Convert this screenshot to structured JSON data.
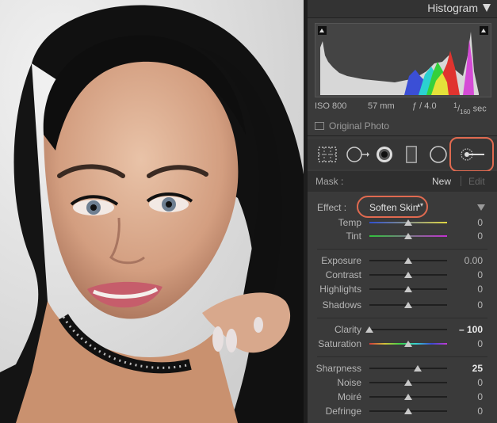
{
  "colors": {
    "accent_highlight": "#e06a50",
    "panel_bg": "#3a3a3a"
  },
  "histogram": {
    "title": "Histogram",
    "iso": "ISO 800",
    "focal_length": "57 mm",
    "aperture": "ƒ / 4.0",
    "shutter_num": "1",
    "shutter_den": "160",
    "shutter_unit": "sec",
    "original_photo_label": "Original Photo"
  },
  "toolbar": {
    "tools": [
      "crop-overlay-icon",
      "spot-removal-icon",
      "red-eye-icon",
      "graduated-filter-icon",
      "radial-filter-icon",
      "adjustment-brush-icon"
    ],
    "active_tool": "adjustment-brush-icon"
  },
  "mask": {
    "label": "Mask :",
    "new_label": "New",
    "edit_label": "Edit"
  },
  "effect": {
    "label": "Effect :",
    "value": "Soften Skin",
    "arrows": "▴▾"
  },
  "sliders": {
    "temp": {
      "label": "Temp",
      "value": "0",
      "level": 0.5
    },
    "tint": {
      "label": "Tint",
      "value": "0",
      "level": 0.5
    },
    "exposure": {
      "label": "Exposure",
      "value": "0.00",
      "level": 0.5
    },
    "contrast": {
      "label": "Contrast",
      "value": "0",
      "level": 0.5
    },
    "highlights": {
      "label": "Highlights",
      "value": "0",
      "level": 0.5
    },
    "shadows": {
      "label": "Shadows",
      "value": "0",
      "level": 0.5
    },
    "clarity": {
      "label": "Clarity",
      "value": "– 100",
      "level": 0.0
    },
    "saturation": {
      "label": "Saturation",
      "value": "0",
      "level": 0.5
    },
    "sharpness": {
      "label": "Sharpness",
      "value": "25",
      "level": 0.62
    },
    "noise": {
      "label": "Noise",
      "value": "0",
      "level": 0.5
    },
    "moire": {
      "label": "Moiré",
      "value": "0",
      "level": 0.5
    },
    "defringe": {
      "label": "Defringe",
      "value": "0",
      "level": 0.5
    }
  }
}
